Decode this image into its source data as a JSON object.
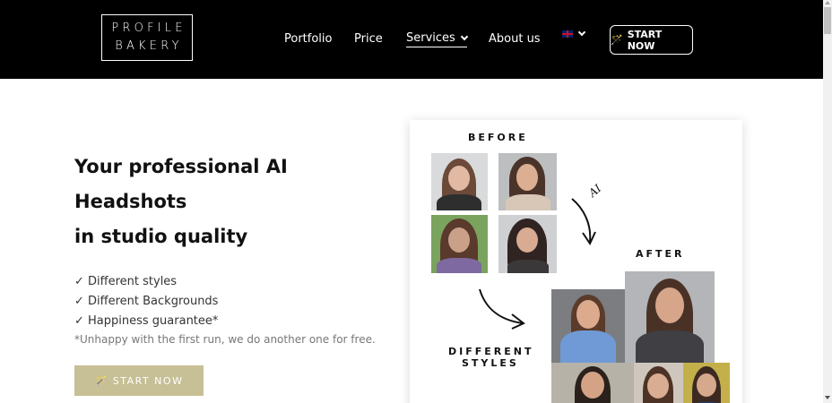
{
  "header": {
    "logo_line1": "PROFILE",
    "logo_line2": "BAKERY",
    "nav": [
      {
        "label": "Portfolio"
      },
      {
        "label": "Price"
      },
      {
        "label": "Services"
      },
      {
        "label": "About us"
      }
    ],
    "language_icon": "uk-flag-icon",
    "cta_label": "START NOW"
  },
  "hero": {
    "title_line1": "Your professional AI",
    "title_line2": "Headshots",
    "title_line3": "in studio quality",
    "bullets": [
      "✓ Different styles",
      "✓ Different Backgrounds",
      "✓ Happiness guarantee*"
    ],
    "note": "*Unhappy with the first run, we do another one for free.",
    "cta_label": "START NOW"
  },
  "showcase": {
    "before_label": "BEFORE",
    "after_label": "AFTER",
    "ai_label": "AI",
    "styles_line1": "DIFFERENT",
    "styles_line2": "STYLES"
  },
  "colors": {
    "header_bg": "#000000",
    "cta_bg": "#c7bf95"
  }
}
